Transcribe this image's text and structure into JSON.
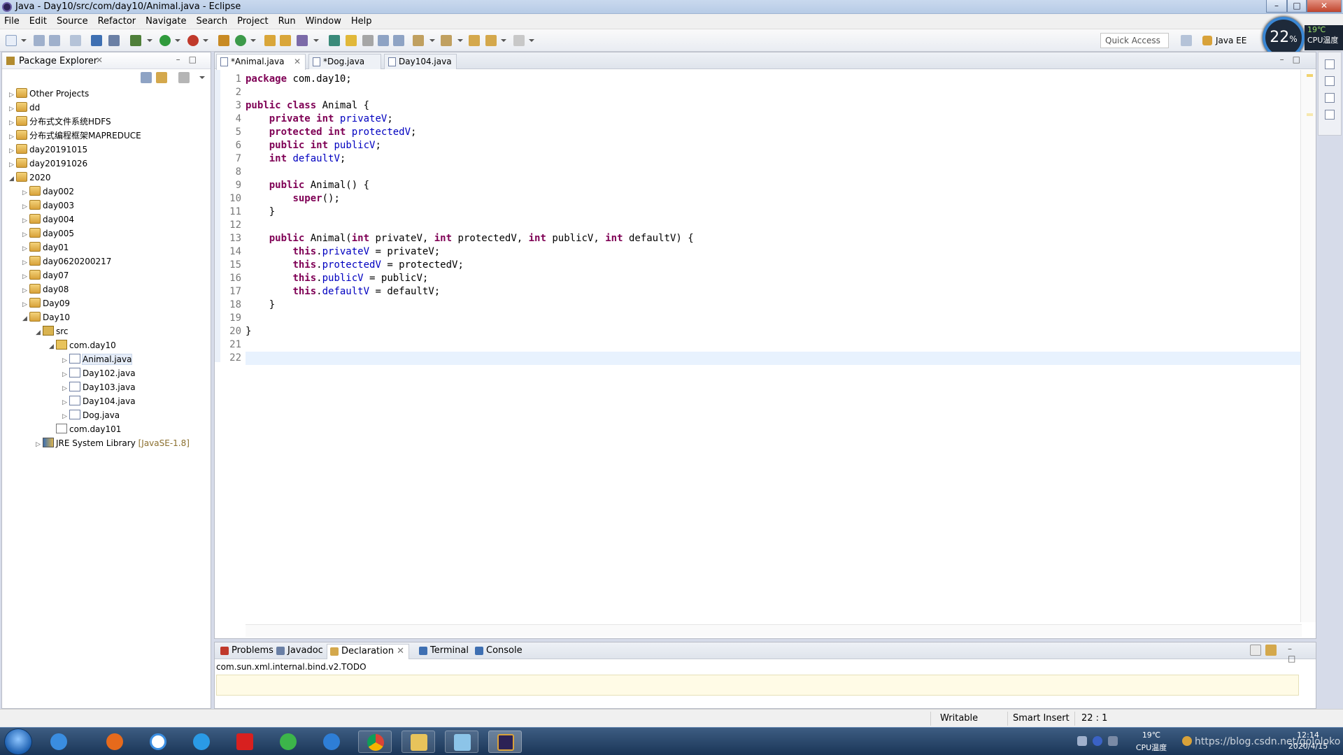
{
  "window": {
    "title": "Java - Day10/src/com/day10/Animal.java - Eclipse"
  },
  "menu": [
    "File",
    "Edit",
    "Source",
    "Refactor",
    "Navigate",
    "Search",
    "Project",
    "Run",
    "Window",
    "Help"
  ],
  "toolbar": {
    "quick_access": "Quick Access",
    "perspective": "Java EE"
  },
  "cpu_widget": {
    "percent": "22",
    "percent_sign": "%",
    "temp": "19℃",
    "label": "CPU温度"
  },
  "package_explorer": {
    "title": "Package Explorer",
    "tree": [
      {
        "label": "Other Projects",
        "depth": 0,
        "expanded": false,
        "icon": "project-icon"
      },
      {
        "label": "dd",
        "depth": 0,
        "expanded": false,
        "icon": "project-icon"
      },
      {
        "label": "分布式文件系统HDFS",
        "depth": 0,
        "expanded": false,
        "icon": "project-icon"
      },
      {
        "label": "分布式编程框架MAPREDUCE",
        "depth": 0,
        "expanded": false,
        "icon": "project-icon"
      },
      {
        "label": "day20191015",
        "depth": 0,
        "expanded": false,
        "icon": "project-icon"
      },
      {
        "label": "day20191026",
        "depth": 0,
        "expanded": false,
        "icon": "project-icon"
      },
      {
        "label": "2020",
        "depth": 0,
        "expanded": true,
        "icon": "project-icon"
      },
      {
        "label": "day002",
        "depth": 1,
        "expanded": false,
        "icon": "project-icon"
      },
      {
        "label": "day003",
        "depth": 1,
        "expanded": false,
        "icon": "project-icon"
      },
      {
        "label": "day004",
        "depth": 1,
        "expanded": false,
        "icon": "project-icon"
      },
      {
        "label": "day005",
        "depth": 1,
        "expanded": false,
        "icon": "project-icon"
      },
      {
        "label": "day01",
        "depth": 1,
        "expanded": false,
        "icon": "project-icon"
      },
      {
        "label": "day0620200217",
        "depth": 1,
        "expanded": false,
        "icon": "project-icon"
      },
      {
        "label": "day07",
        "depth": 1,
        "expanded": false,
        "icon": "project-icon"
      },
      {
        "label": "day08",
        "depth": 1,
        "expanded": false,
        "icon": "project-icon"
      },
      {
        "label": "Day09",
        "depth": 1,
        "expanded": false,
        "icon": "project-icon"
      },
      {
        "label": "Day10",
        "depth": 1,
        "expanded": true,
        "icon": "project-icon"
      },
      {
        "label": "src",
        "depth": 2,
        "expanded": true,
        "icon": "source-folder-icon"
      },
      {
        "label": "com.day10",
        "depth": 3,
        "expanded": true,
        "icon": "package-icon"
      },
      {
        "label": "Animal.java",
        "depth": 4,
        "expanded": false,
        "icon": "java-file-icon",
        "selected": true
      },
      {
        "label": "Day102.java",
        "depth": 4,
        "expanded": false,
        "icon": "java-file-icon"
      },
      {
        "label": "Day103.java",
        "depth": 4,
        "expanded": false,
        "icon": "java-file-icon"
      },
      {
        "label": "Day104.java",
        "depth": 4,
        "expanded": false,
        "icon": "java-file-icon"
      },
      {
        "label": "Dog.java",
        "depth": 4,
        "expanded": false,
        "icon": "java-file-icon"
      },
      {
        "label": "com.day101",
        "depth": 3,
        "expanded": null,
        "icon": "empty-package-icon"
      },
      {
        "label": "JRE System Library",
        "tag": "[JavaSE-1.8]",
        "depth": 2,
        "expanded": false,
        "icon": "library-icon"
      }
    ]
  },
  "editor": {
    "tabs": [
      {
        "label": "*Animal.java",
        "active": true
      },
      {
        "label": "*Dog.java",
        "active": false
      },
      {
        "label": "Day104.java",
        "active": false
      }
    ],
    "lines": [
      "package com.day10;",
      "",
      "public class Animal {",
      "    private int privateV;",
      "    protected int protectedV;",
      "    public int publicV;",
      "    int defaultV;",
      "",
      "    public Animal() {",
      "        super();",
      "    }",
      "",
      "    public Animal(int privateV, int protectedV, int publicV, int defaultV) {",
      "        this.privateV = privateV;",
      "        this.protectedV = protectedV;",
      "        this.publicV = publicV;",
      "        this.defaultV = defaultV;",
      "    }",
      "",
      "}",
      "",
      ""
    ],
    "current_line": 22
  },
  "bottom_view": {
    "tabs": [
      {
        "label": "Problems",
        "active": false
      },
      {
        "label": "Javadoc",
        "active": false
      },
      {
        "label": "Declaration",
        "active": true
      },
      {
        "label": "Terminal",
        "active": false
      },
      {
        "label": "Console",
        "active": false
      }
    ],
    "declaration_text": "com.sun.xml.internal.bind.v2.TODO"
  },
  "status_bar": {
    "writable": "Writable",
    "insert_mode": "Smart Insert",
    "position": "22 : 1"
  },
  "taskbar": {
    "apps": [
      "ie-icon",
      "firefox-icon",
      "baidu-netdisk-icon",
      "cloud-icon",
      "youdao-icon",
      "360-icon",
      "ie-alt-icon",
      "chrome-icon",
      "explorer-icon",
      "notes-icon",
      "eclipse-icon"
    ],
    "temp": "19℃",
    "temp_label": "CPU温度",
    "time": "12:14",
    "date": "2020/4/15",
    "watermark": "https://blog.csdn.net/gololoko"
  },
  "colors": {
    "keyword": "#7f0055",
    "field": "#0000c0",
    "current_line": "#e8f2fe"
  }
}
